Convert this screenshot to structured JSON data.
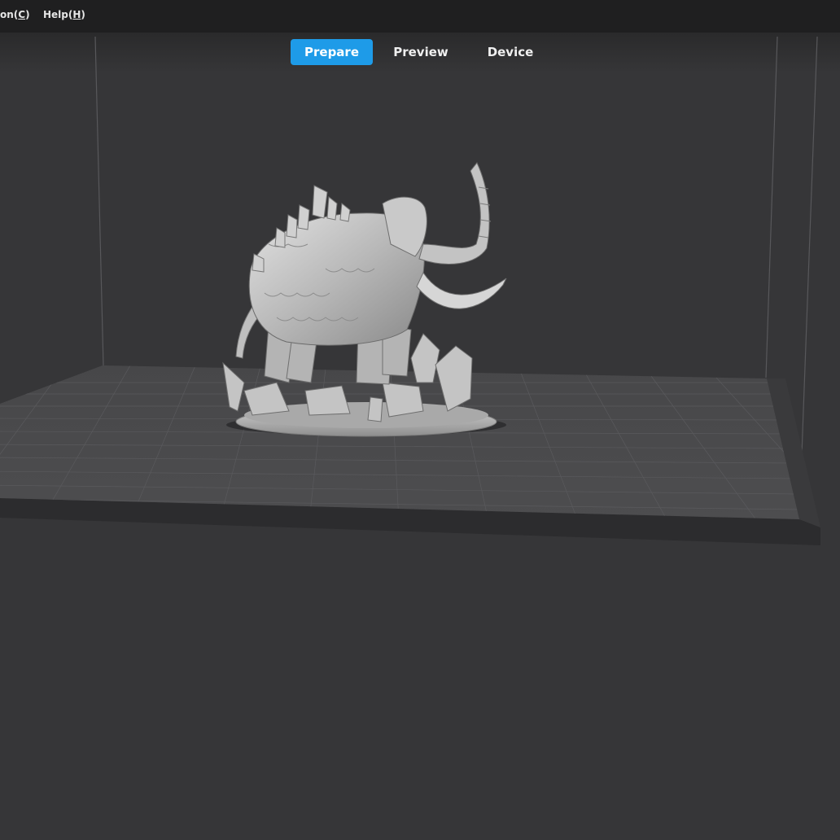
{
  "menu": {
    "items": [
      {
        "label_prefix": "on(",
        "accel": "C",
        "label_suffix": ")"
      },
      {
        "label_prefix": "Help(",
        "accel": "H",
        "label_suffix": ")"
      }
    ]
  },
  "tabs": [
    {
      "label": "Prepare",
      "active": true
    },
    {
      "label": "Preview",
      "active": false
    },
    {
      "label": "Device",
      "active": false
    }
  ],
  "colors": {
    "accent": "#1e9be8",
    "viewport_bg": "#363638",
    "menubar_bg": "#1f1f20",
    "plate": "#4a4a4c",
    "model": "#bdbdbd"
  },
  "viewport": {
    "object": "mammoth-model",
    "build_plate_grid": true
  }
}
